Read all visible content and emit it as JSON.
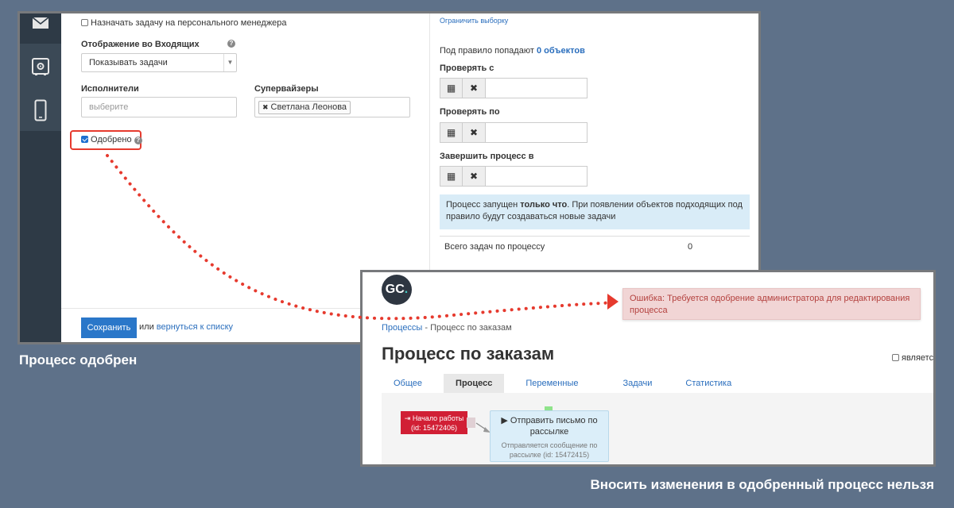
{
  "shot1": {
    "assign_manager_label": "Назначать задачу на персонального менеджера",
    "inbox_display": {
      "label": "Отображение во Входящих",
      "value": "Показывать задачи"
    },
    "executors": {
      "label": "Исполнители",
      "placeholder": "выберите"
    },
    "supervisors": {
      "label": "Супервайзеры",
      "tag": "Светлана Леонова"
    },
    "approved_label": "Одобрено",
    "limit_link": "Ограничить выборку",
    "rule_text": "Под правило попадают",
    "rule_count": "0 объектов",
    "check_from_label": "Проверять с",
    "check_to_label": "Проверять по",
    "finish_label": "Завершить процесс в",
    "info": {
      "prefix": "Процесс запущен ",
      "bold": "только что",
      "suffix": ". При появлении объектов подходящих под правило будут создаваться новые задачи"
    },
    "total_tasks_label": "Всего задач по процессу",
    "total_tasks_value": "0",
    "save_label": "Сохранить",
    "or_text": "или",
    "back_link": "вернуться к списку"
  },
  "caption_left": "Процесс одобрен",
  "caption_right": "Вносить изменения в одобренный процесс нельзя",
  "shot2": {
    "logo_text": "GC",
    "logo_dot": ".",
    "alert": "Ошибка: Требуется одобрение администратора для редактирования процесса",
    "breadcrumb_root": "Процессы",
    "breadcrumb_sep": " - ",
    "breadcrumb_current": "Процесс по заказам",
    "title": "Процесс по заказам",
    "checkbox_label": "является",
    "tabs": [
      {
        "label": "Общее"
      },
      {
        "label": "Процесс"
      },
      {
        "label": "Переменные"
      },
      {
        "label": "Задачи"
      },
      {
        "label": "Статистика"
      }
    ],
    "start_node": {
      "label": "Начало работы",
      "id": "(id: 15472406)"
    },
    "send_node": {
      "title": "Отправить письмо по рассылке",
      "subtitle": "Отправляется сообщение по рассылке (id: 15472415)"
    }
  },
  "colors": {
    "background": "#5e7189",
    "highlight": "#e63a2e",
    "primary": "#2a77c9",
    "alert_bg": "#f1d5d5",
    "alert_text": "#b4423f",
    "start_node": "#d11f35"
  }
}
